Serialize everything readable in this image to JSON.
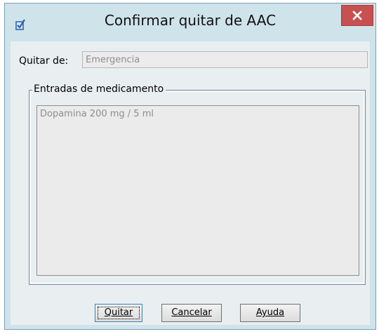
{
  "window": {
    "title": "Confirmar quitar de AAC"
  },
  "form": {
    "remove_from_label": "Quitar de:",
    "remove_from_value": "Emergencia"
  },
  "group": {
    "legend": "Entradas de medicamento",
    "items": [
      "Dopamina 200 mg / 5 ml"
    ]
  },
  "buttons": {
    "remove_label": "Quitar",
    "cancel_label": "Cancelar",
    "help_label": "Ayuda"
  },
  "colors": {
    "frame": "#cfe3eb",
    "client": "#e9eef0",
    "close_button": "#c75050",
    "group_border": "#7a86b8"
  },
  "icons": {
    "app": "app-icon",
    "close": "close-icon"
  }
}
